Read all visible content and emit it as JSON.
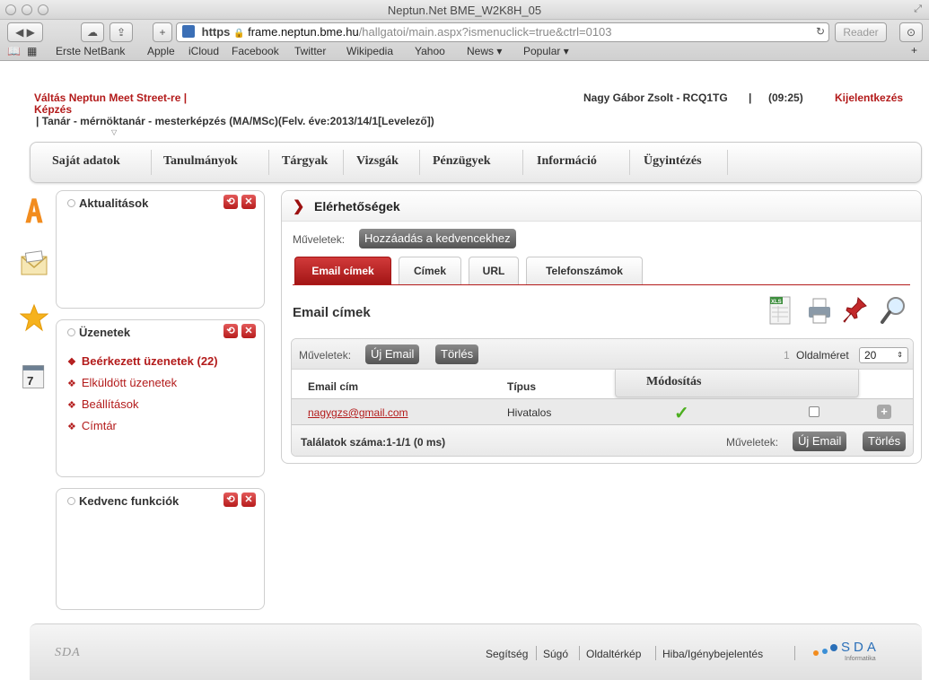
{
  "browser": {
    "window_title": "Neptun.Net BME_W2K8H_05",
    "url_scheme": "https",
    "url_host": "frame.neptun.bme.hu",
    "url_path": "/hallgatoi/main.aspx?ismenuclick=true&ctrl=0103",
    "reader_label": "Reader",
    "bookmarks": [
      "Erste NetBank",
      "Apple",
      "iCloud",
      "Facebook",
      "Twitter",
      "Wikipedia",
      "Yahoo",
      "News ▾",
      "Popular ▾"
    ]
  },
  "header": {
    "switch_link": "Váltás Neptun Meet Street-re |",
    "training_label": "Képzés",
    "user": "Nagy Gábor Zsolt - RCQ1TG",
    "time": "(09:25)",
    "separator": "|",
    "logout": "Kijelentkezés",
    "role": "| Tanár - mérnöktanár - mesterképzés (MA/MSc)(Felv. éve:2013/14/1[Levelező])"
  },
  "main_menu": [
    "Saját adatok",
    "Tanulmányok",
    "Tárgyak",
    "Vizsgák",
    "Pénzügyek",
    "Információ",
    "Ügyintézés"
  ],
  "sidebar": {
    "news": {
      "title": "Aktualitások"
    },
    "messages": {
      "title": "Üzenetek",
      "items": [
        "Beérkezett üzenetek (22)",
        "Elküldött üzenetek",
        "Beállítások",
        "Címtár"
      ]
    },
    "favorites": {
      "title": "Kedvenc funkciók"
    },
    "rail_icons": [
      "letter-a-icon",
      "envelope-icon",
      "star-icon",
      "calendar-icon"
    ]
  },
  "panel": {
    "title": "Elérhetőségek",
    "ops_label": "Műveletek:",
    "add_favorite": "Hozzáadás a kedvencekhez",
    "tabs": [
      "Email címek",
      "Címek",
      "URL",
      "Telefonszámok"
    ],
    "active_tab": "Email címek",
    "section_title": "Email címek",
    "tool_icons": [
      "excel-export-icon",
      "print-icon",
      "pin-icon",
      "search-icon"
    ],
    "grid": {
      "ops_label": "Műveletek:",
      "new_email": "Új Email",
      "delete": "Törlés",
      "page_number": "1",
      "page_size_label": "Oldalméret",
      "page_size": "20",
      "columns": [
        "Email cím",
        "Típus"
      ],
      "modify_header": "Módosítás",
      "rows": [
        {
          "email": "nagygzs@gmail.com",
          "type": "Hivatalos",
          "modified": true,
          "selected": false
        }
      ],
      "results": "Találatok száma:1-1/1 (0 ms)",
      "footer_ops_label": "Műveletek:",
      "footer_new_email": "Új Email",
      "footer_delete": "Törlés"
    }
  },
  "footer": {
    "logo_left": "SDA",
    "links": [
      "Segítség",
      "Súgó",
      "Oldaltérkép",
      "Hiba/Igénybejelentés"
    ],
    "logo_right": "SDA",
    "logo_right_sub": "Informatika"
  }
}
